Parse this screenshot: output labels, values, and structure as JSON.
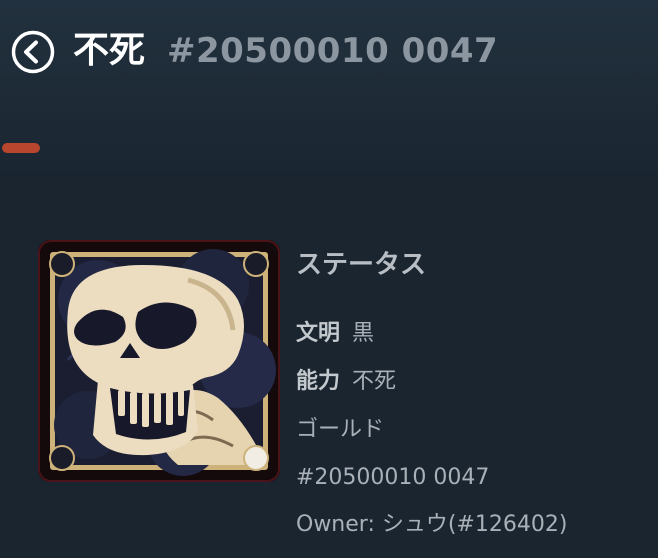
{
  "header": {
    "title": "不死",
    "token_id": "#20500010 0047"
  },
  "status": {
    "heading": "ステータス",
    "civilization_label": "文明",
    "civilization_value": "黒",
    "ability_label": "能力",
    "ability_value": "不死",
    "rarity": "ゴールド",
    "token_id": "#20500010 0047",
    "owner": "Owner: シュウ(#126402)"
  },
  "colors": {
    "background": "#1a2530",
    "frame_gold": "#cdb27a",
    "skull": "#ecdcc0"
  },
  "icons": {
    "back": "back-arrow-circle-icon",
    "card_art": "skull-icon"
  }
}
